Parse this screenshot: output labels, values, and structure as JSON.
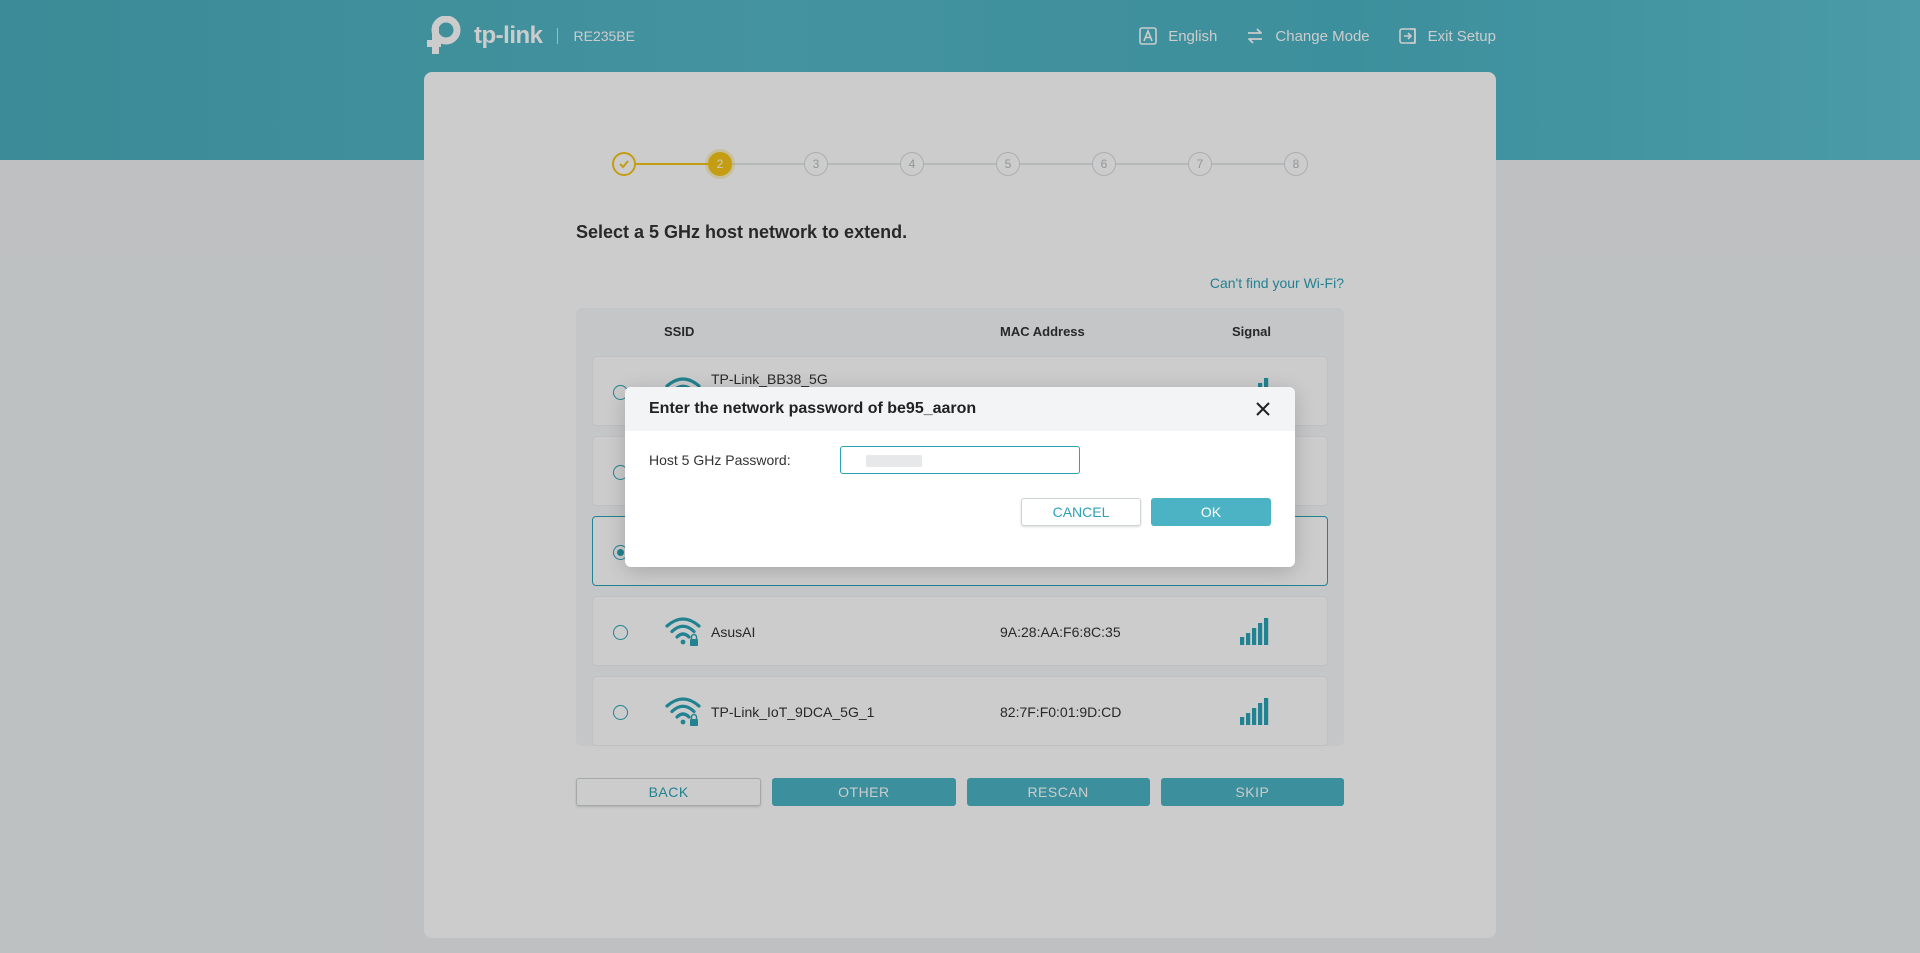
{
  "header": {
    "brand": "tp-link",
    "model": "RE235BE",
    "actions": [
      {
        "label": "English",
        "icon": "language-icon"
      },
      {
        "label": "Change Mode",
        "icon": "change-mode-icon"
      },
      {
        "label": "Exit Setup",
        "icon": "exit-icon"
      }
    ]
  },
  "stepper": {
    "steps": [
      "1",
      "2",
      "3",
      "4",
      "5",
      "6",
      "7",
      "8"
    ],
    "current": 2,
    "accent": "#f5c518"
  },
  "page": {
    "title": "Select a 5 GHz host network to extend.",
    "help_link": "Can't find your Wi-Fi?"
  },
  "table": {
    "columns": {
      "ssid": "SSID",
      "mac": "MAC Address",
      "signal": "Signal"
    },
    "rows": [
      {
        "ssid": "TP-Link_BB38_5G",
        "mac": "",
        "signal": 4,
        "selected": false
      },
      {
        "ssid": "",
        "mac": "",
        "signal": 4,
        "selected": false
      },
      {
        "ssid": "",
        "mac": "",
        "signal": 4,
        "selected": true
      },
      {
        "ssid": "AsusAI",
        "mac": "9A:28:AA:F6:8C:35",
        "signal": 4,
        "selected": false
      },
      {
        "ssid": "TP-Link_IoT_9DCA_5G_1",
        "mac": "82:7F:F0:01:9D:CD",
        "signal": 4,
        "selected": false
      }
    ]
  },
  "buttons": {
    "back": "BACK",
    "other": "OTHER",
    "rescan": "RESCAN",
    "skip": "SKIP"
  },
  "modal": {
    "title": "Enter the network password of be95_aaron",
    "field_label": "Host 5 GHz Password:",
    "password_value": "",
    "cancel": "CANCEL",
    "ok": "OK"
  },
  "colors": {
    "brand_teal": "#4cb3c4",
    "link_teal": "#2aa3b6"
  }
}
